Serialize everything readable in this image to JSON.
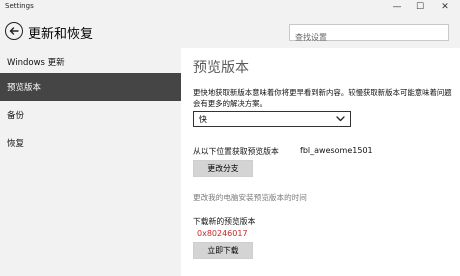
{
  "window": {
    "title": "Settings",
    "controls": {
      "minimize": "—",
      "maximize": "☐",
      "close": "✕"
    }
  },
  "header": {
    "title": "更新和恢复",
    "search_placeholder": "查找设置"
  },
  "sidebar": {
    "items": [
      {
        "label": "Windows 更新",
        "active": false
      },
      {
        "label": "预览版本",
        "active": true
      },
      {
        "label": "备份",
        "active": false
      },
      {
        "label": "恢复",
        "active": false
      }
    ]
  },
  "main": {
    "title": "预览版本",
    "description": "更快地获取新版本意味着你将更早看到新内容。较慢获取新版本可能意味着问题会有更多的解决方案。",
    "ring_dropdown": {
      "selected": "快"
    },
    "account": {
      "label": "从以下位置获取预览版本",
      "value": "fbl_awesome1501"
    },
    "change_branch_button": "更改分支",
    "change_time_link": "更改我的电脑安装预览版本的时间",
    "download": {
      "title": "下载新的预览版本",
      "error_code": "0x80246017",
      "retry_button": "立即下载"
    }
  },
  "colors": {
    "chrome_bg": "#f2f2f2",
    "active_nav_bg": "#454545",
    "error": "#c62828",
    "button_bg": "#d4d4d4"
  }
}
